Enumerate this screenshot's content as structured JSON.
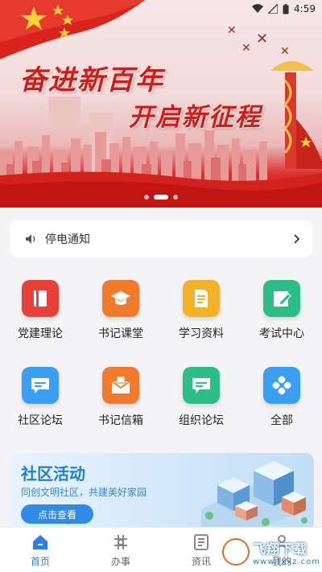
{
  "status": {
    "time": "4:59"
  },
  "banner": {
    "slogan_line1": "奋进新百年",
    "slogan_line2": "开启新征程",
    "slide_count": 3,
    "active_slide": 2
  },
  "notice": {
    "label": "停电通知",
    "icon": "speaker-icon"
  },
  "menu": [
    {
      "label": "党建理论",
      "icon": "book-icon",
      "color": "#e8413a"
    },
    {
      "label": "书记课堂",
      "icon": "graduation-cap-icon",
      "color": "#f07b2c"
    },
    {
      "label": "学习资料",
      "icon": "document-icon",
      "color": "#f3b22a"
    },
    {
      "label": "考试中心",
      "icon": "exam-edit-icon",
      "color": "#2dbd86"
    },
    {
      "label": "社区论坛",
      "icon": "chat-bubble-icon",
      "color": "#3a9ff0"
    },
    {
      "label": "书记信箱",
      "icon": "mailbox-icon",
      "color": "#f07b2c"
    },
    {
      "label": "组织论坛",
      "icon": "chat-bubble-icon",
      "color": "#2dbd86"
    },
    {
      "label": "全部",
      "icon": "grid-all-icon",
      "color": "#3a9ff0"
    }
  ],
  "activity": {
    "title": "社区活动",
    "subtitle": "同创文明社区，共建美好家园",
    "button": "点击查看"
  },
  "tabs": [
    {
      "label": "首页",
      "icon": "home-icon",
      "active": true
    },
    {
      "label": "办事",
      "icon": "service-icon",
      "active": false
    },
    {
      "label": "资讯",
      "icon": "news-icon",
      "active": false
    },
    {
      "label": "我的",
      "icon": "profile-icon",
      "active": false
    }
  ],
  "watermark": {
    "main": "飞翔下载",
    "sub": "www.fxxz.com"
  },
  "colors": {
    "brand_red": "#d11d18",
    "accent_blue": "#2f7fe0"
  }
}
